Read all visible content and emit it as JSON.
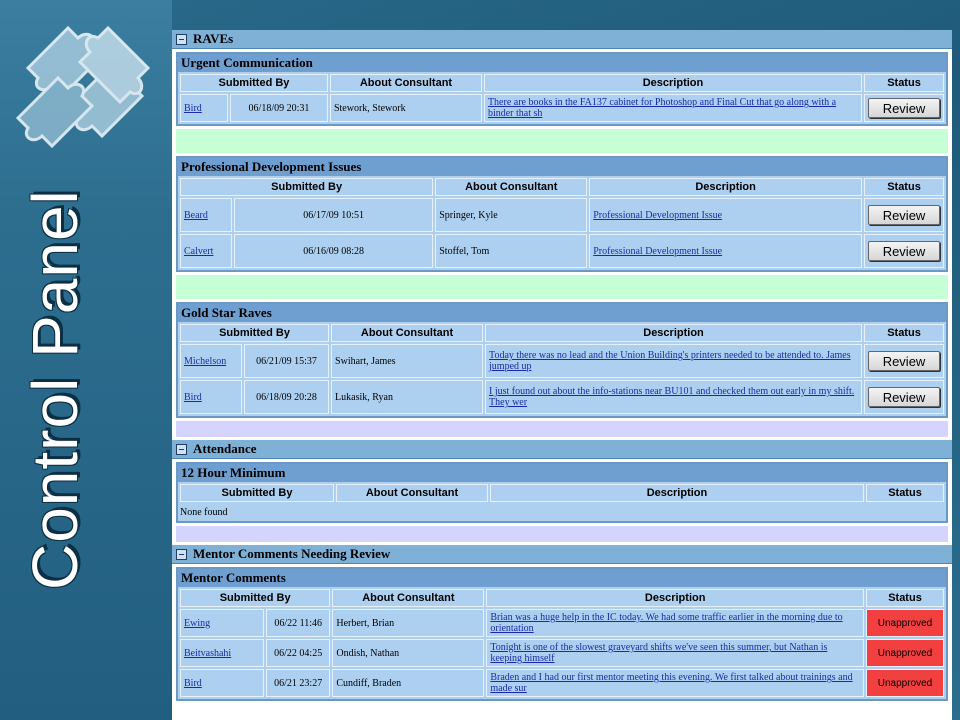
{
  "slide": {
    "title": "Control Panel"
  },
  "colors": {
    "accent": "#7fb0d6",
    "unapproved": "#f24040",
    "green_spacer": "#c6ffd6",
    "purple_spacer": "#d5d4ff"
  },
  "columns": [
    "Submitted By",
    "About Consultant",
    "Description",
    "Status"
  ],
  "raves": {
    "header": "RAVEs",
    "urgent": {
      "title": "Urgent Communication",
      "rows": [
        {
          "by": "Bird",
          "date": "06/18/09 20:31",
          "consultant": "Stework, Stework",
          "description": "There are books in the FA137 cabinet for Photoshop and Final Cut that go along with a binder that sh",
          "status": "Review"
        }
      ]
    },
    "prodev": {
      "title": "Professional Development Issues",
      "rows": [
        {
          "by": "Beard",
          "date": "06/17/09 10:51",
          "consultant": "Springer, Kyle",
          "description": "Professional Development Issue",
          "status": "Review"
        },
        {
          "by": "Calvert",
          "date": "06/16/09 08:28",
          "consultant": "Stoffel, Tom",
          "description": "Professional Development Issue",
          "status": "Review"
        }
      ]
    },
    "goldstar": {
      "title": "Gold Star Raves",
      "rows": [
        {
          "by": "Michelson",
          "date": "06/21/09 15:37",
          "consultant": "Swihart, James",
          "description": "Today there was no lead and the Union Building's printers needed to be attended to. James jumped up",
          "status": "Review"
        },
        {
          "by": "Bird",
          "date": "06/18/09 20:28",
          "consultant": "Lukasik, Ryan",
          "description": "I just found out about the info-stations near BU101 and checked them out early in my shift. They wer",
          "status": "Review"
        }
      ]
    }
  },
  "attendance": {
    "header": "Attendance",
    "minimum": {
      "title": "12 Hour Minimum",
      "empty": "None found"
    }
  },
  "mentor": {
    "header": "Mentor Comments Needing Review",
    "comments": {
      "title": "Mentor Comments",
      "rows": [
        {
          "by": "Ewing",
          "date": "06/22 11:46",
          "consultant": "Herbert, Brian",
          "description": "Brian was a huge help in the IC today. We had some traffic earlier in the morning due to orientation",
          "status": "Unapproved"
        },
        {
          "by": "Beitvashahi",
          "date": "06/22 04:25",
          "consultant": "Ondish, Nathan",
          "description": "Tonight is one of the slowest graveyard shifts we've seen this summer, but Nathan is keeping himself",
          "status": "Unapproved"
        },
        {
          "by": "Bird",
          "date": "06/21 23:27",
          "consultant": "Cundiff, Braden",
          "description": "Braden and I had our first mentor meeting this evening. We first talked about trainings and made sur",
          "status": "Unapproved"
        }
      ]
    }
  }
}
